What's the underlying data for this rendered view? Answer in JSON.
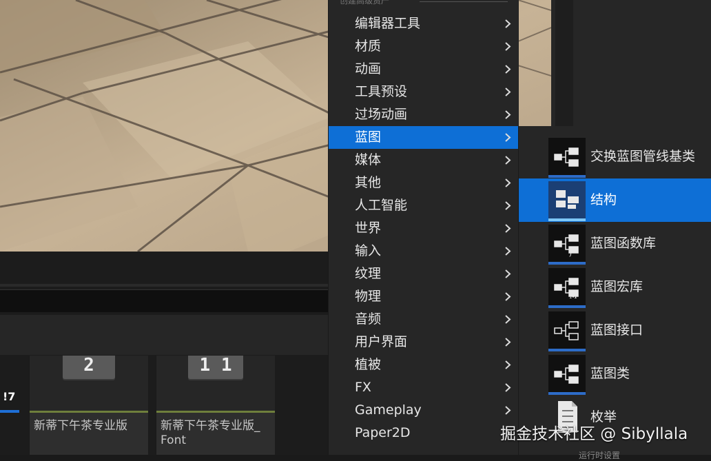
{
  "menu": {
    "header": "创建高级资产",
    "items": [
      {
        "label": "编辑器工具"
      },
      {
        "label": "材质"
      },
      {
        "label": "动画"
      },
      {
        "label": "工具预设"
      },
      {
        "label": "过场动画"
      },
      {
        "label": "蓝图",
        "active": true
      },
      {
        "label": "媒体"
      },
      {
        "label": "其他"
      },
      {
        "label": "人工智能"
      },
      {
        "label": "世界"
      },
      {
        "label": "输入"
      },
      {
        "label": "纹理"
      },
      {
        "label": "物理"
      },
      {
        "label": "音频"
      },
      {
        "label": "用户界面"
      },
      {
        "label": "植被"
      },
      {
        "label": "FX"
      },
      {
        "label": "Gameplay"
      },
      {
        "label": "Paper2D"
      }
    ]
  },
  "submenu": {
    "items": [
      {
        "label": "交换蓝图管线基类",
        "icon": "blueprint-icon"
      },
      {
        "label": "结构",
        "icon": "struct-icon",
        "active": true
      },
      {
        "label": "蓝图函数库",
        "icon": "blueprint-function-library-icon",
        "glyph": "f"
      },
      {
        "label": "蓝图宏库",
        "icon": "blueprint-macro-library-icon",
        "glyph": "M"
      },
      {
        "label": "蓝图接口",
        "icon": "blueprint-interface-icon"
      },
      {
        "label": "蓝图类",
        "icon": "blueprint-class-icon"
      },
      {
        "label": "枚举",
        "icon": "enum-icon"
      }
    ]
  },
  "content_browser": {
    "assets": [
      {
        "name": "新蒂下午茶专业版",
        "glyph": "2"
      },
      {
        "name": "新蒂下午茶专业版_\nFont",
        "glyph": "1 1"
      }
    ],
    "partial_glyph": "!7"
  },
  "colors": {
    "menu_bg": "#262626",
    "highlight": "#0e6fd6",
    "asset_accent": "#6f7f3c"
  },
  "overlay": {
    "watermark": "掘金技术社区 @ Sibyllala",
    "bottom_peek": "运行时设置"
  }
}
